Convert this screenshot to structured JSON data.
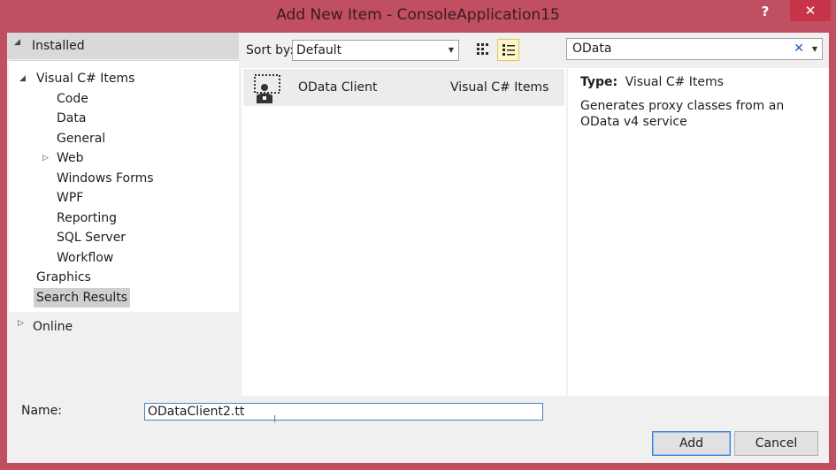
{
  "window": {
    "title": "Add New Item - ConsoleApplication15",
    "help_label": "?",
    "close_label": "✕"
  },
  "left": {
    "installed_label": "Installed",
    "tree": {
      "root": "Visual C# Items",
      "children": [
        "Code",
        "Data",
        "General",
        "Web",
        "Windows Forms",
        "WPF",
        "Reporting",
        "SQL Server",
        "Workflow"
      ],
      "siblings": [
        "Graphics",
        "Search Results"
      ]
    },
    "online_label": "Online"
  },
  "toolbar": {
    "sort_label": "Sort by:",
    "sort_value": "Default",
    "views": [
      {
        "icon": "small-icons-view-icon",
        "active": false
      },
      {
        "icon": "list-view-icon",
        "active": true
      }
    ]
  },
  "items": [
    {
      "name": "OData Client",
      "category": "Visual C# Items",
      "icon": "odata-client-icon"
    }
  ],
  "search": {
    "value": "OData",
    "clear_label": "✕"
  },
  "details": {
    "type_label": "Type:",
    "type_value": "Visual C# Items",
    "description": "Generates proxy classes from an OData v4 service"
  },
  "footer": {
    "name_label": "Name:",
    "name_value": "ODataClient2.tt",
    "add_label": "Add",
    "cancel_label": "Cancel"
  },
  "colors": {
    "frame": "#c14f62",
    "close_button": "#c7344a",
    "selected_item": "#ececec",
    "active_view": "#fff6c7"
  }
}
